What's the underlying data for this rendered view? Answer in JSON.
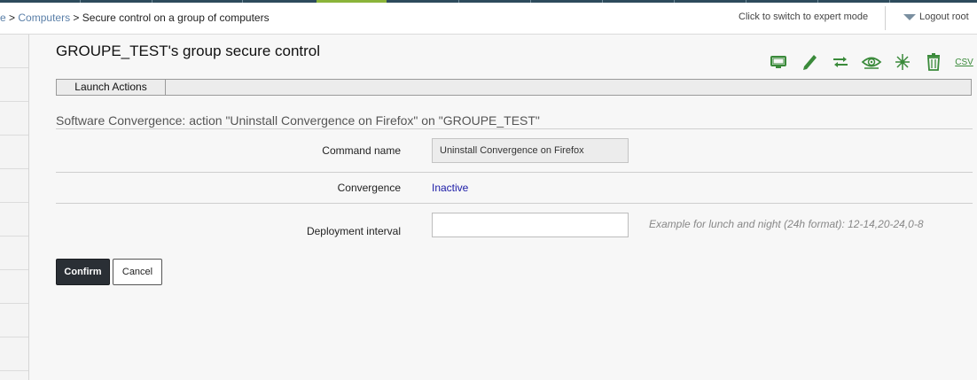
{
  "header": {
    "breadcrumb": {
      "home": "e",
      "separator": ">",
      "computers": "Computers",
      "current": "Secure control on a group of computers"
    },
    "expert_mode": "Click to switch to expert mode",
    "logout": "Logout root"
  },
  "page": {
    "title": "GROUPE_TEST's group secure control",
    "toolbar": {
      "csv_label": "CSV",
      "icons": [
        "desktop-icon",
        "pencil-icon",
        "transfer-arrows-icon",
        "eye-icon",
        "sparkle-icon",
        "trash-icon",
        "csv-icon"
      ]
    },
    "tabs": [
      {
        "label": "Launch Actions"
      }
    ],
    "section_title": "Software Convergence: action \"Uninstall Convergence on Firefox\" on \"GROUPE_TEST\"",
    "form": {
      "command_name_label": "Command name",
      "command_name_value": "Uninstall Convergence on Firefox",
      "convergence_label": "Convergence",
      "convergence_value": "Inactive",
      "interval_label": "Deployment interval",
      "interval_value": "",
      "interval_hint": "Example for lunch and night (24h format): 12-14,20-24,0-8"
    },
    "buttons": {
      "confirm": "Confirm",
      "cancel": "Cancel"
    }
  },
  "colors": {
    "accent_green": "#3a8a3a",
    "nav_dark": "#2d4b5c",
    "nav_accent": "#8bb43a",
    "link_blue": "#1a1aa6"
  }
}
